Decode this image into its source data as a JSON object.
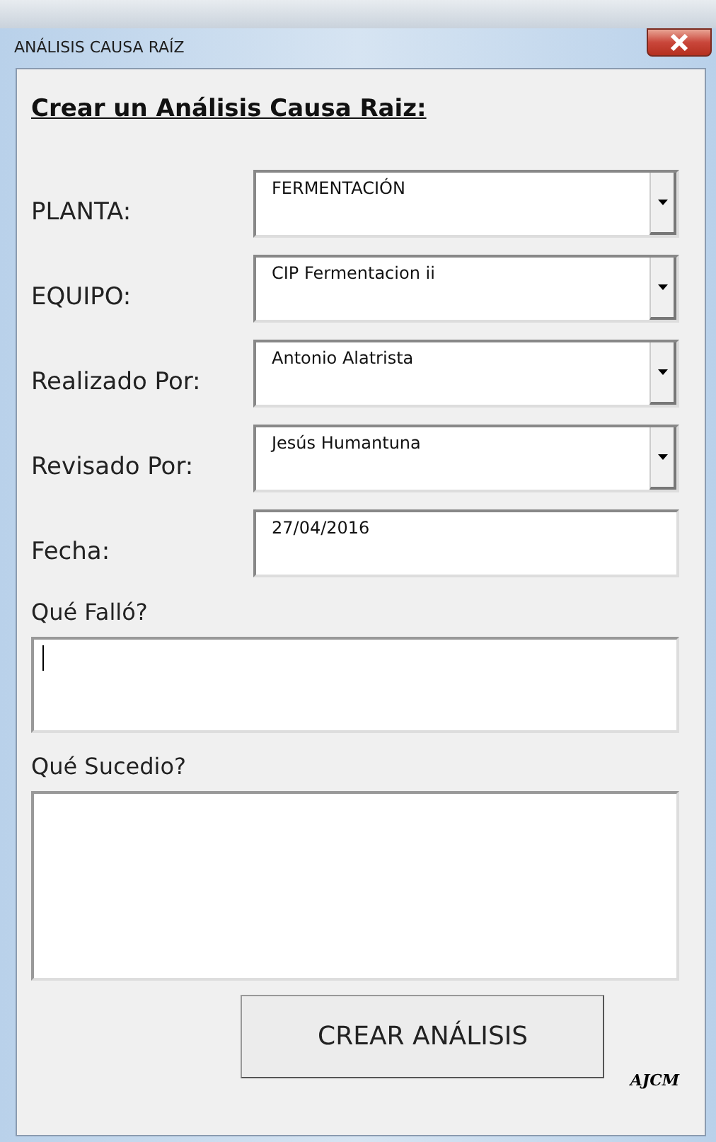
{
  "window": {
    "title": "ANÁLISIS CAUSA RAÍZ"
  },
  "heading": "Crear un Análisis Causa Raiz:",
  "fields": [
    {
      "kind": "combo",
      "label": "PLANTA:",
      "value": "FERMENTACIÓN"
    },
    {
      "kind": "combo",
      "label": "EQUIPO:",
      "value": "CIP Fermentacion ii"
    },
    {
      "kind": "combo",
      "label": "Realizado Por:",
      "value": "Antonio Alatrista"
    },
    {
      "kind": "combo",
      "label": "Revisado Por:",
      "value": "Jesús Humantuna"
    },
    {
      "kind": "text",
      "label": "Fecha:",
      "value": "27/04/2016"
    }
  ],
  "memos": [
    {
      "label": "Qué Falló?",
      "focused": true
    },
    {
      "label": "Qué Sucedio?",
      "focused": false
    }
  ],
  "button": "CREAR ANÁLISIS",
  "signature": "AJCM"
}
